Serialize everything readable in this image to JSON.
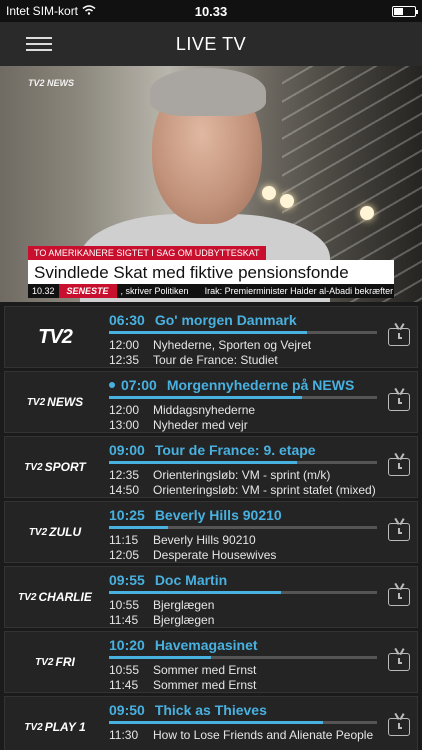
{
  "status_bar": {
    "carrier": "Intet SIM-kort",
    "time": "10.33"
  },
  "nav": {
    "title": "LIVE TV"
  },
  "video": {
    "channel_bug": "NEWS",
    "ticker_top": "TO AMERIKANERE SIGTET I SAG OM UDBYTTESKAT",
    "ticker_headline": "Svindlede Skat med fiktive pensionsfonde",
    "ticker_time": "10.32",
    "ticker_label": "SENESTE",
    "ticker_items": [
      ", skriver Politiken",
      "Irak: Premierminister Haider al-Abadi bekræfter m"
    ]
  },
  "channels": [
    {
      "logo": "TV2",
      "logo_sub": "",
      "now_time": "06:30",
      "now_title": "Go' morgen Danmark",
      "live_dot": false,
      "progress": 0.74,
      "next": [
        {
          "time": "12:00",
          "title": "Nyhederne, Sporten og Vejret"
        },
        {
          "time": "12:35",
          "title": "Tour de France: Studiet"
        }
      ]
    },
    {
      "logo": "TV2",
      "logo_sub": "NEWS",
      "now_time": "07:00",
      "now_title": "Morgennyhederne på NEWS",
      "live_dot": true,
      "progress": 0.72,
      "next": [
        {
          "time": "12:00",
          "title": "Middagsnyhederne"
        },
        {
          "time": "13:00",
          "title": "Nyheder med vejr"
        }
      ]
    },
    {
      "logo": "TV2",
      "logo_sub": "SPORT",
      "now_time": "09:00",
      "now_title": "Tour de France: 9. etape",
      "live_dot": false,
      "progress": 0.7,
      "next": [
        {
          "time": "12:35",
          "title": "Orienteringsløb: VM - sprint (m/k)"
        },
        {
          "time": "14:50",
          "title": "Orienteringsløb: VM - sprint stafet (mixed)"
        }
      ]
    },
    {
      "logo": "TV2",
      "logo_sub": "ZULU",
      "now_time": "10:25",
      "now_title": "Beverly Hills 90210",
      "live_dot": false,
      "progress": 0.22,
      "next": [
        {
          "time": "11:15",
          "title": "Beverly Hills 90210"
        },
        {
          "time": "12:05",
          "title": "Desperate Housewives"
        }
      ]
    },
    {
      "logo": "TV2",
      "logo_sub": "CHARLIE",
      "now_time": "09:55",
      "now_title": "Doc Martin",
      "live_dot": false,
      "progress": 0.64,
      "next": [
        {
          "time": "10:55",
          "title": "Bjerglægen"
        },
        {
          "time": "11:45",
          "title": "Bjerglægen"
        }
      ]
    },
    {
      "logo": "TV2",
      "logo_sub": "FRI",
      "now_time": "10:20",
      "now_title": "Havemagasinet",
      "live_dot": false,
      "progress": 0.38,
      "next": [
        {
          "time": "10:55",
          "title": "Sommer med Ernst"
        },
        {
          "time": "11:45",
          "title": "Sommer med Ernst"
        }
      ]
    },
    {
      "logo": "TV2",
      "logo_sub": "PLAY 1",
      "now_time": "09:50",
      "now_title": "Thick as Thieves",
      "live_dot": false,
      "progress": 0.8,
      "next": [
        {
          "time": "11:30",
          "title": "How to Lose Friends and Alienate People"
        }
      ]
    }
  ],
  "colors": {
    "accent": "#48b1e0",
    "ticker_red": "#c8102e"
  }
}
